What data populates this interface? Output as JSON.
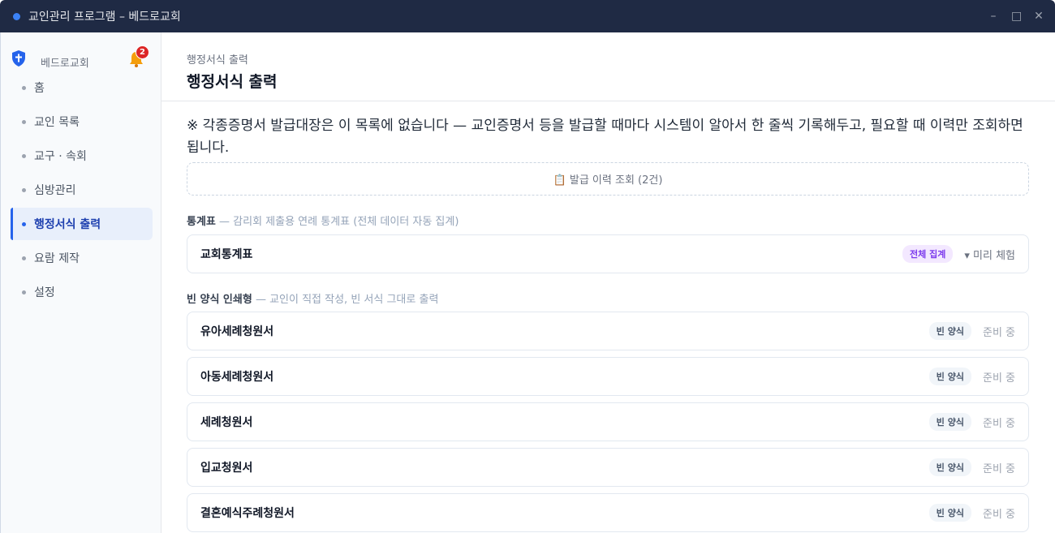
{
  "window": {
    "title": "교인관리 프로그램  –  베드로교회",
    "controls": [
      "–",
      "□",
      "✕"
    ]
  },
  "sidebar": {
    "brand": "베드로교회",
    "notification_count": "2",
    "items": [
      {
        "label": "홈"
      },
      {
        "label": "교인 목록"
      },
      {
        "label": "교구 · 속회"
      },
      {
        "label": "심방관리"
      },
      {
        "label": "행정서식 출력"
      },
      {
        "label": "요람 제작"
      },
      {
        "label": "설정"
      }
    ],
    "active_index": 4
  },
  "header": {
    "breadcrumb": "행정서식 출력",
    "title": "행정서식 출력"
  },
  "notice": "※ 각종증명서 발급대장은 이 목록에 없습니다 — 교인증명서 등을 발급할 때마다 시스템이 알아서 한 줄씩 기록해두고, 필요할 때 이력만 조회하면 됩니다.",
  "history_button": "📋 발급 이력 조회 (2건)",
  "sections": {
    "stats": {
      "title": "통계표",
      "desc": " — 감리회 제출용 연례 통계표 (전체 데이터 자동 집계)",
      "cards": [
        {
          "title": "교회통계표",
          "tag": "전체 집계",
          "action": "▾ 미리 체험"
        }
      ]
    },
    "blank": {
      "title": "빈 양식 인쇄형",
      "desc": " — 교인이 직접 작성, 빈 서식 그대로 출력",
      "cards": [
        {
          "title": "유아세례청원서",
          "tag": "빈 양식",
          "status": "준비 중"
        },
        {
          "title": "아동세례청원서",
          "tag": "빈 양식",
          "status": "준비 중"
        },
        {
          "title": "세례청원서",
          "tag": "빈 양식",
          "status": "준비 중"
        },
        {
          "title": "입교청원서",
          "tag": "빈 양식",
          "status": "준비 중"
        },
        {
          "title": "결혼예식주례청원서",
          "tag": "빈 양식",
          "status": "준비 중"
        }
      ]
    }
  },
  "colors": {
    "titlebar": "#1f2a44",
    "accent": "#2563eb",
    "badge": "#dc2626",
    "tag_all": "#7c3aed"
  }
}
